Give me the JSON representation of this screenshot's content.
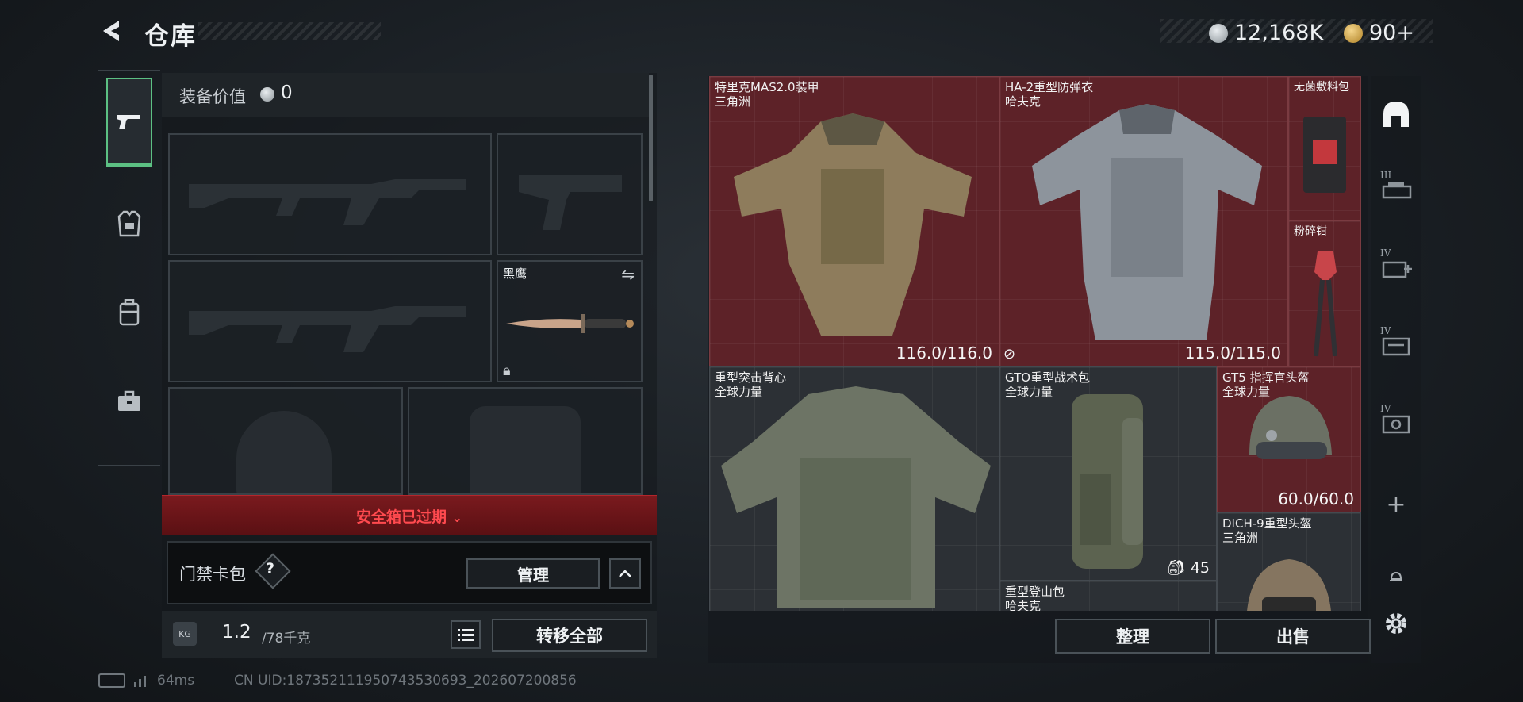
{
  "header": {
    "title": "仓库",
    "currency": {
      "silver": "12,168K",
      "gold": "90+"
    }
  },
  "nav": {
    "tabs": [
      {
        "name": "weapon-tab",
        "icon": "pistol-icon",
        "active": true
      },
      {
        "name": "equipment-tab",
        "icon": "vest-icon",
        "active": false
      },
      {
        "name": "backpack-tab",
        "icon": "backpack-icon",
        "active": false
      },
      {
        "name": "case-tab",
        "icon": "briefcase-icon",
        "active": false
      }
    ]
  },
  "loadout": {
    "value_label": "装备价值",
    "value": "0",
    "melee_name": "黑鹰",
    "secure_case_status": "安全箱已过期",
    "keycard_label": "门禁卡包",
    "keycard_help": "?",
    "manage_label": "管理",
    "weight": "1.2",
    "weight_max": "/78千克",
    "transfer_all_label": "转移全部"
  },
  "stash": {
    "items": [
      {
        "name": "特里克MAS2.0装甲",
        "maker": "三角洲",
        "durability": "116.0/116.0"
      },
      {
        "name": "HA-2重型防弹衣",
        "maker": "哈夫克",
        "durability": "115.0/115.0"
      },
      {
        "name": "无菌敷料包",
        "maker": "",
        "durability": ""
      },
      {
        "name": "粉碎钳",
        "maker": "",
        "durability": ""
      },
      {
        "name": "重型突击背心",
        "maker": "全球力量",
        "durability": ""
      },
      {
        "name": "GTO重型战术包",
        "maker": "全球力量",
        "durability": "",
        "capacity": "45"
      },
      {
        "name": "GT5 指挥官头盔",
        "maker": "全球力量",
        "durability": "60.0/60.0"
      },
      {
        "name": "DICH-9重型头盔",
        "maker": "三角洲",
        "durability": ""
      },
      {
        "name": "重型登山包",
        "maker": "哈夫克",
        "durability": ""
      }
    ],
    "sort_label": "整理",
    "sell_label": "出售"
  },
  "right_nav": {
    "tiers": [
      "III",
      "IV",
      "IV",
      "IV"
    ],
    "add": "+"
  },
  "status_bar": {
    "ping": "64ms",
    "uid": "CN UID:18735211195074353069​3_202607200856"
  },
  "colors": {
    "accent_green": "#5cc083",
    "alert_red": "#e0383e",
    "item_red": "#5d2228"
  }
}
